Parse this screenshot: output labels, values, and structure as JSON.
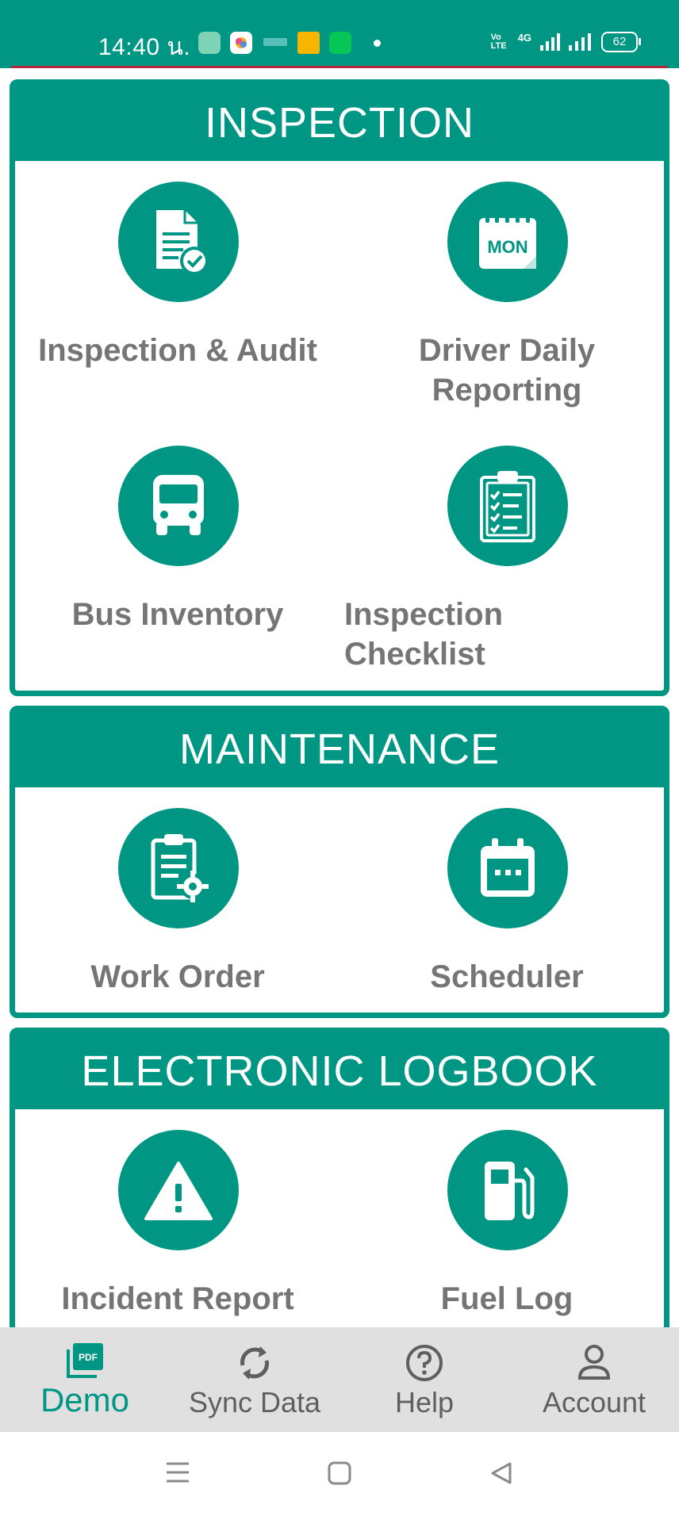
{
  "status_bar": {
    "time": "14:40 น.",
    "battery": "62",
    "network": "4G",
    "volte": "Vo LTE"
  },
  "sections": {
    "inspection": {
      "title": "INSPECTION",
      "tiles": [
        {
          "label": "Inspection & Audit",
          "icon": "document-check-icon"
        },
        {
          "label": "Driver Daily Reporting",
          "icon": "calendar-mon-icon"
        },
        {
          "label": "Bus Inventory",
          "icon": "bus-icon"
        },
        {
          "label": "Inspection Checklist",
          "icon": "clipboard-checklist-icon"
        }
      ]
    },
    "maintenance": {
      "title": "MAINTENANCE",
      "tiles": [
        {
          "label": "Work Order",
          "icon": "clipboard-gear-icon"
        },
        {
          "label": "Scheduler",
          "icon": "calendar-icon"
        }
      ]
    },
    "logbook": {
      "title": "ELECTRONIC LOGBOOK",
      "tiles": [
        {
          "label": "Incident Report",
          "icon": "warning-icon"
        },
        {
          "label": "Fuel Log",
          "icon": "fuel-pump-icon"
        }
      ]
    }
  },
  "bottom_nav": {
    "items": [
      {
        "label": "Demo",
        "icon": "pdf-icon",
        "active": true
      },
      {
        "label": "Sync Data",
        "icon": "sync-icon",
        "active": false
      },
      {
        "label": "Help",
        "icon": "help-icon",
        "active": false
      },
      {
        "label": "Account",
        "icon": "account-icon",
        "active": false
      }
    ]
  },
  "icon_texts": {
    "mon": "MON",
    "pdf": "PDF"
  },
  "colors": {
    "primary": "#009684",
    "label_gray": "#757575",
    "nav_background": "#e0e0e0"
  }
}
